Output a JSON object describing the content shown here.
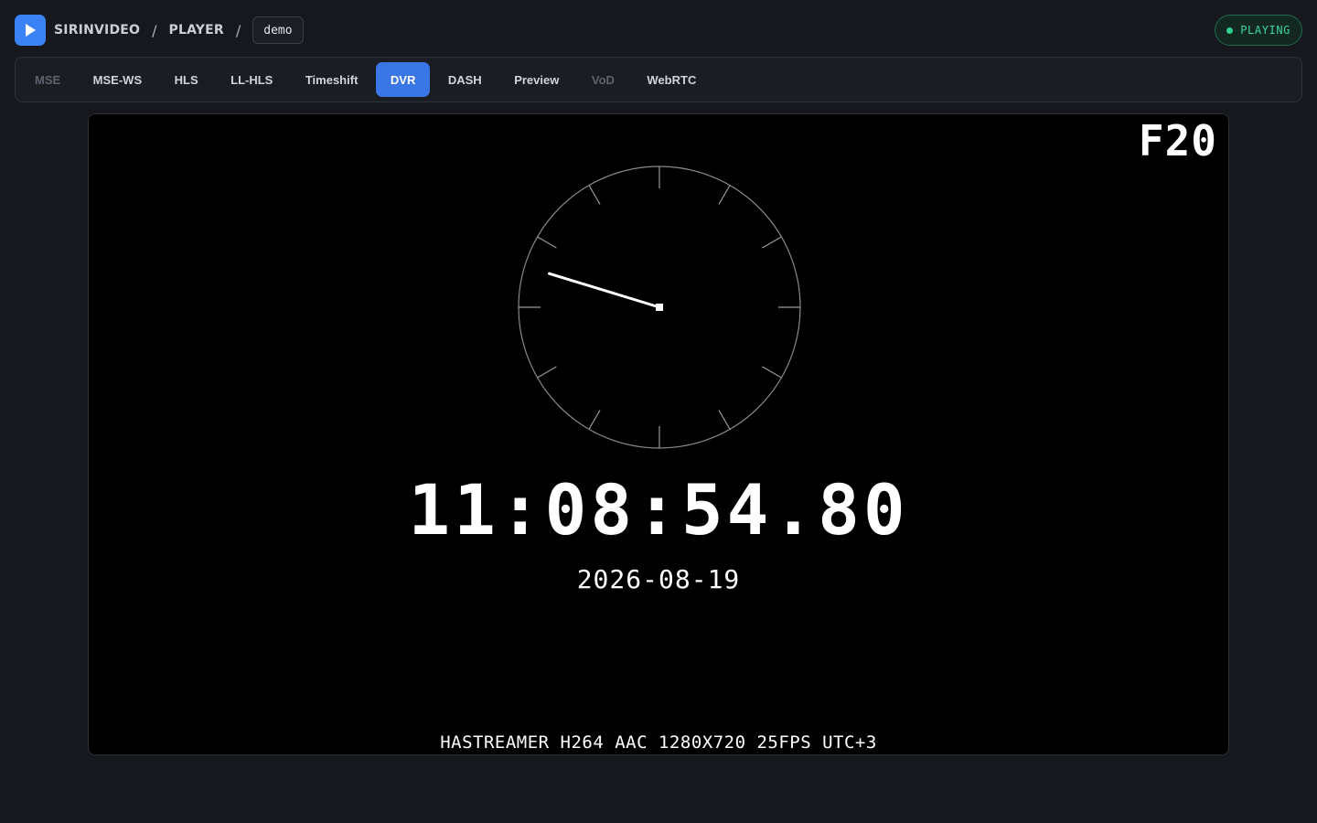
{
  "app": {
    "name": "SIRINVIDEO",
    "section": "PLAYER",
    "stream": "demo"
  },
  "status": {
    "label": "PLAYING",
    "color": "#2fd190"
  },
  "tabs": [
    {
      "label": "MSE",
      "state": "disabled"
    },
    {
      "label": "MSE-WS",
      "state": "normal"
    },
    {
      "label": "HLS",
      "state": "normal"
    },
    {
      "label": "LL-HLS",
      "state": "normal"
    },
    {
      "label": "Timeshift",
      "state": "normal"
    },
    {
      "label": "DVR",
      "state": "active"
    },
    {
      "label": "DASH",
      "state": "normal"
    },
    {
      "label": "Preview",
      "state": "normal"
    },
    {
      "label": "VoD",
      "state": "disabled"
    },
    {
      "label": "WebRTC",
      "state": "normal"
    }
  ],
  "video": {
    "frame_tag": "F20",
    "time": "11:08:54.80",
    "date": "2026-08-19",
    "info": "HASTREAMER H264 AAC 1280X720 25FPS UTC+3",
    "clock": {
      "hand_angle_deg": 287
    }
  },
  "icons": {
    "logo": "play-icon",
    "status": "dot-icon"
  },
  "colors": {
    "accent": "#3b76e6",
    "background": "#16181d"
  }
}
